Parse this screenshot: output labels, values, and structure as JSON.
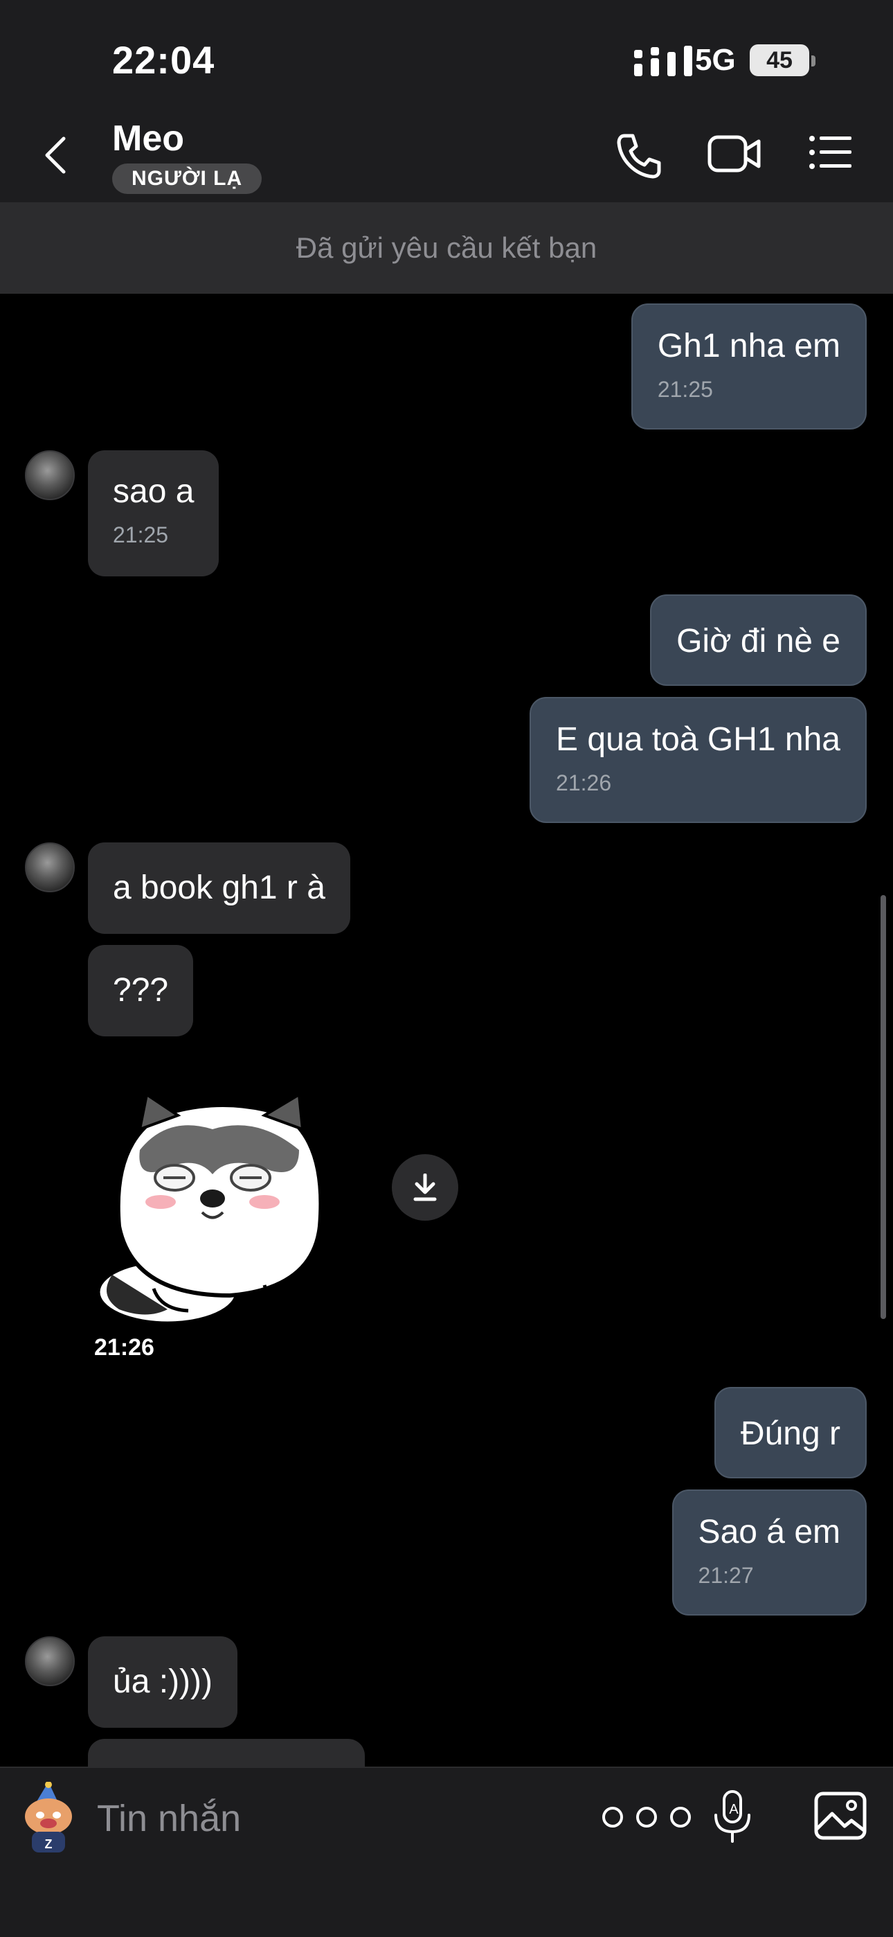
{
  "status_bar": {
    "time": "22:04",
    "network": "5G",
    "battery": "45"
  },
  "header": {
    "name": "Meo",
    "badge": "NGƯỜI LẠ"
  },
  "banner": {
    "text": "Đã gửi yêu cầu kết bạn"
  },
  "messages": [
    {
      "from": "me",
      "text": "Gh1 nha em",
      "time": "21:25"
    },
    {
      "from": "them",
      "text": "sao a",
      "time": "21:25"
    },
    {
      "from": "me",
      "text": "Giờ đi nè e"
    },
    {
      "from": "me",
      "text": "E qua toà GH1 nha",
      "time": "21:26"
    },
    {
      "from": "them",
      "text": "a book gh1 r à"
    },
    {
      "from": "them",
      "text": "???"
    },
    {
      "from": "them",
      "type": "sticker",
      "time": "21:26"
    },
    {
      "from": "me",
      "text": "Đúng r"
    },
    {
      "from": "me",
      "text": "Sao á em",
      "time": "21:27"
    },
    {
      "from": "them",
      "text": "ủa :))))"
    }
  ],
  "input": {
    "placeholder": "Tin nhắn"
  },
  "icons": {
    "back": "chevron-left-icon",
    "call": "phone-icon",
    "video": "video-camera-icon",
    "menu": "list-icon",
    "more": "more-dots-icon",
    "voice": "microphone-icon",
    "gallery": "image-icon",
    "download": "download-icon"
  },
  "colors": {
    "out_bubble": "#3a4655",
    "in_bubble": "#2c2c2e",
    "header": "#1d1d1f"
  }
}
